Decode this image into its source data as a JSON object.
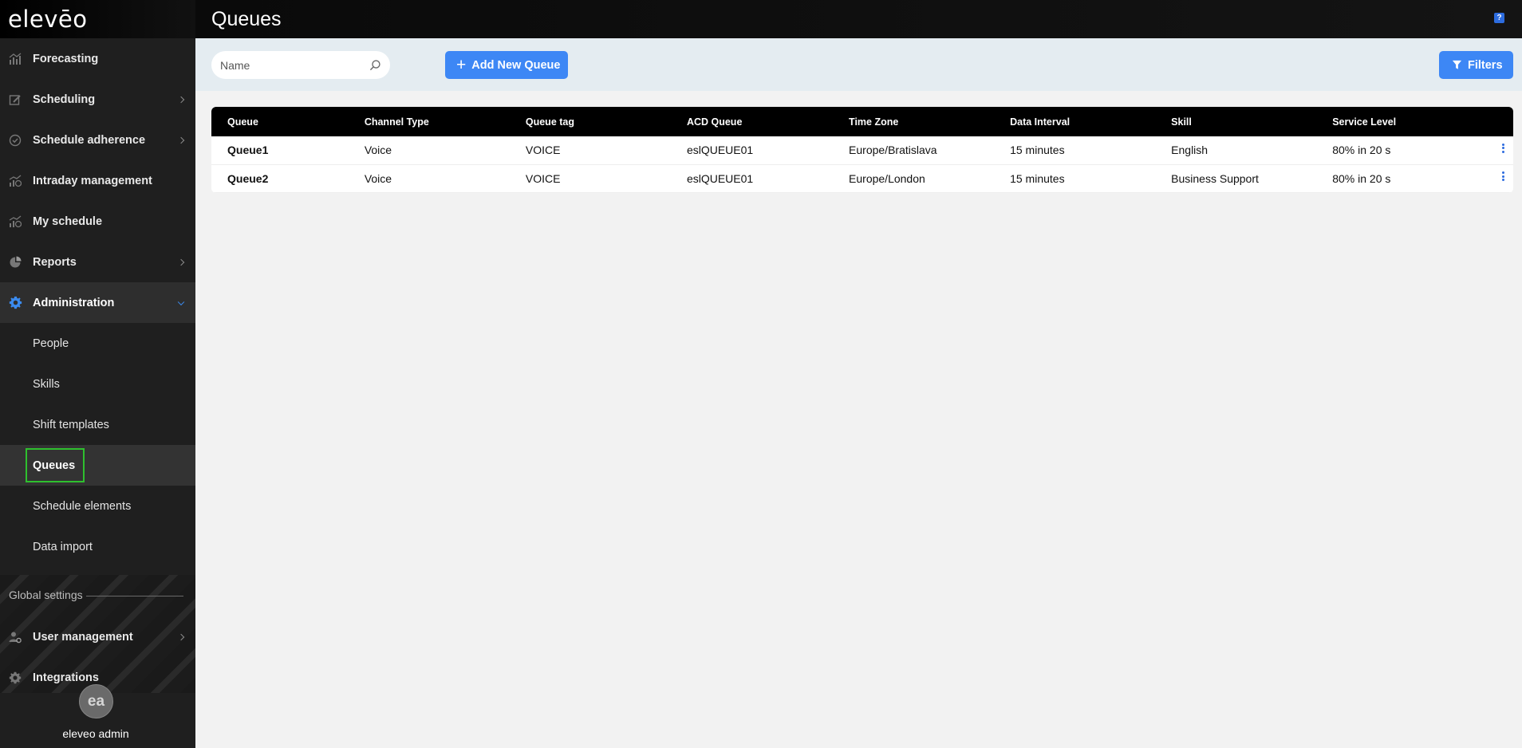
{
  "app": {
    "logo": "elevēo",
    "page_title": "Queues"
  },
  "sidebar": {
    "items": [
      {
        "label": "Forecasting",
        "icon": "chart-bars-icon",
        "has_children": false
      },
      {
        "label": "Scheduling",
        "icon": "calendar-edit-icon",
        "has_children": true
      },
      {
        "label": "Schedule adherence",
        "icon": "check-circle-icon",
        "has_children": true
      },
      {
        "label": "Intraday management",
        "icon": "intraday-chart-icon",
        "has_children": false
      },
      {
        "label": "My schedule",
        "icon": "my-schedule-icon",
        "has_children": false
      },
      {
        "label": "Reports",
        "icon": "pie-chart-icon",
        "has_children": true
      },
      {
        "label": "Administration",
        "icon": "gear-icon",
        "has_children": true,
        "expanded": true
      }
    ],
    "admin_sub": [
      {
        "label": "People"
      },
      {
        "label": "Skills"
      },
      {
        "label": "Shift templates"
      },
      {
        "label": "Queues",
        "active": true
      },
      {
        "label": "Schedule elements"
      },
      {
        "label": "Data import"
      }
    ],
    "global_settings_label": "Global settings",
    "global_items": [
      {
        "label": "User management",
        "icon": "user-gear-icon",
        "has_children": true
      },
      {
        "label": "Integrations",
        "icon": "gear-icon",
        "has_children": false
      }
    ],
    "user": {
      "initials": "ea",
      "name": "eleveo admin"
    }
  },
  "toolbar": {
    "search_placeholder": "Name",
    "add_button": "Add New Queue",
    "filters_button": "Filters"
  },
  "table": {
    "columns": [
      "Queue",
      "Channel Type",
      "Queue tag",
      "ACD Queue",
      "Time Zone",
      "Data Interval",
      "Skill",
      "Service Level"
    ],
    "rows": [
      [
        "Queue1",
        "Voice",
        "VOICE",
        "eslQUEUE01",
        "Europe/Bratislava",
        "15 minutes",
        "English",
        "80% in 20 s"
      ],
      [
        "Queue2",
        "Voice",
        "VOICE",
        "eslQUEUE01",
        "Europe/London",
        "15 minutes",
        "Business Support",
        "80% in 20 s"
      ]
    ]
  },
  "colors": {
    "accent": "#3d87f5",
    "highlight_border": "#2ec02e",
    "sidebar_bg": "#1f1f1f",
    "toolbar_bg": "#e4ecf1"
  }
}
